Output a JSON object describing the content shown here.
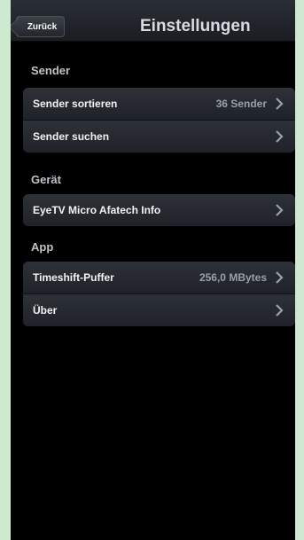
{
  "navbar": {
    "back_label": "Zurück",
    "title": "Einstellungen"
  },
  "sections": [
    {
      "title": "Sender",
      "rows": [
        {
          "label": "Sender sortieren",
          "value": "36 Sender"
        },
        {
          "label": "Sender suchen",
          "value": ""
        }
      ]
    },
    {
      "title": "Gerät",
      "rows": [
        {
          "label": "EyeTV Micro Afatech Info",
          "value": ""
        }
      ]
    },
    {
      "title": "App",
      "rows": [
        {
          "label": "Timeshift-Puffer",
          "value": "256,0 MBytes"
        },
        {
          "label": "Über",
          "value": ""
        }
      ]
    }
  ],
  "icons": {
    "back": "chevron-left-icon",
    "row_disclosure": "chevron-right-icon"
  },
  "colors": {
    "page_background": "#cfe9d0",
    "screen_background": "#000000",
    "row_text": "#f2f3f5",
    "value_text": "#9aa0a8"
  }
}
